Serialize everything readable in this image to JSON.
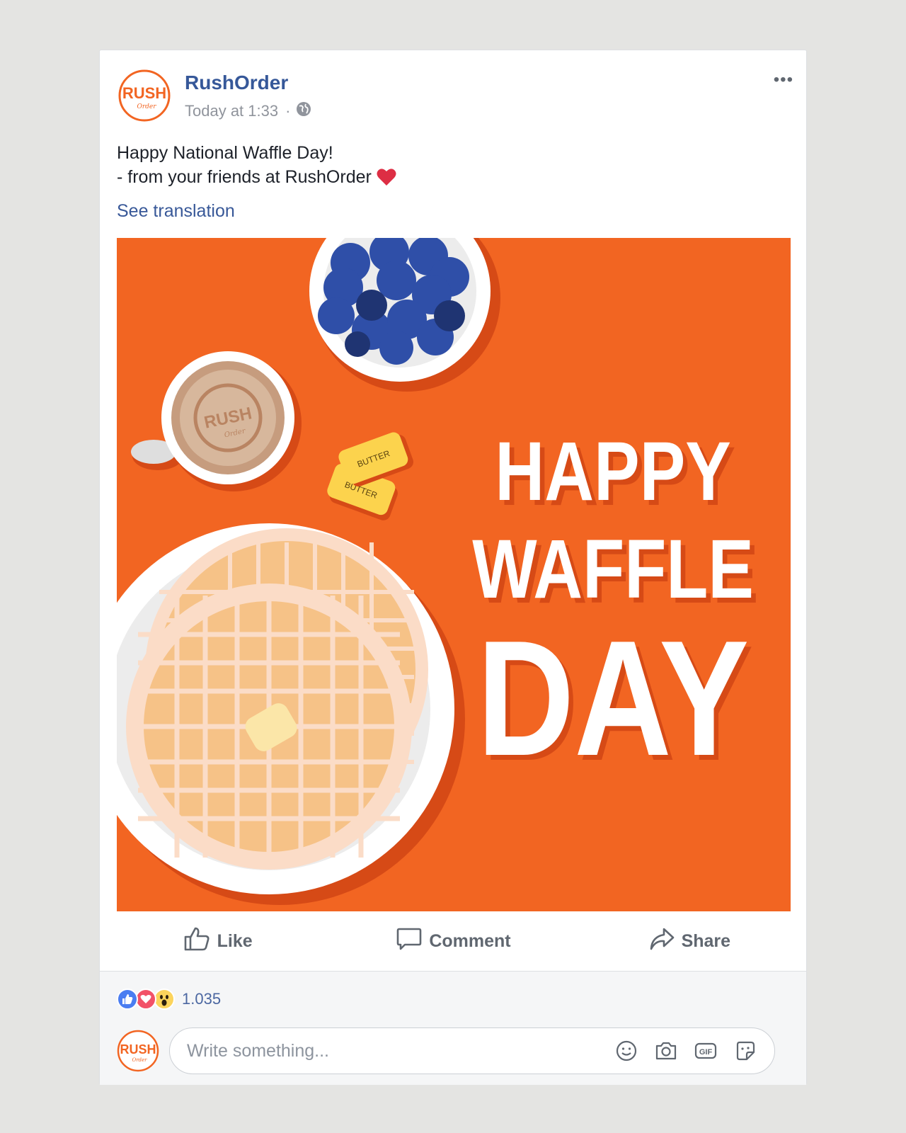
{
  "post": {
    "page_name": "RushOrder",
    "timestamp": "Today at 1:33",
    "separator": "·",
    "more_label": "•••",
    "message_line1": "Happy National Waffle Day!",
    "message_line2": "- from your friends at RushOrder",
    "message_emoji": "❤️",
    "see_translation": "See translation",
    "image": {
      "headline_1": "HAPPY",
      "headline_2": "WAFFLE",
      "headline_3": "DAY",
      "butter_label_1": "BUTTER",
      "butter_label_2": "BUTTER",
      "mug_logo": "RUSH",
      "mug_logo_sub": "Order"
    },
    "logo": {
      "main": "RUSH",
      "sub": "Order"
    }
  },
  "actions": {
    "like": "Like",
    "comment": "Comment",
    "share": "Share"
  },
  "reactions": {
    "count": "1.035",
    "types": [
      "like-icon",
      "love-icon",
      "wow-icon"
    ]
  },
  "comment": {
    "placeholder": "Write something...",
    "icons": [
      "emoji-icon",
      "camera-icon",
      "gif-icon",
      "sticker-icon"
    ]
  },
  "colors": {
    "brand_orange": "#f26522",
    "link_blue": "#365899",
    "blueberry": "#2f4fa8"
  }
}
